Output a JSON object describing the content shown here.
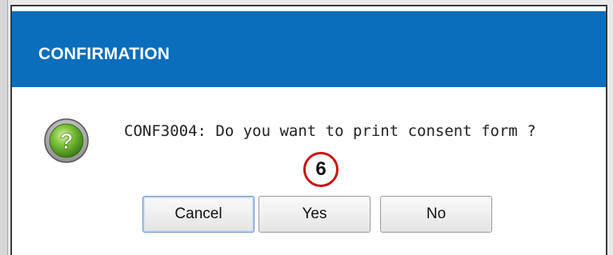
{
  "dialog": {
    "title": "CONFIRMATION",
    "message": "CONF3004: Do you want to print consent form ?",
    "icon": "help-question-icon",
    "step_badge": "6",
    "buttons": {
      "cancel": "Cancel",
      "yes": "Yes",
      "no": "No"
    }
  },
  "colors": {
    "titlebar": "#0a6ebd",
    "badge_ring": "#cc1111",
    "icon_green": "#5fa82e"
  }
}
